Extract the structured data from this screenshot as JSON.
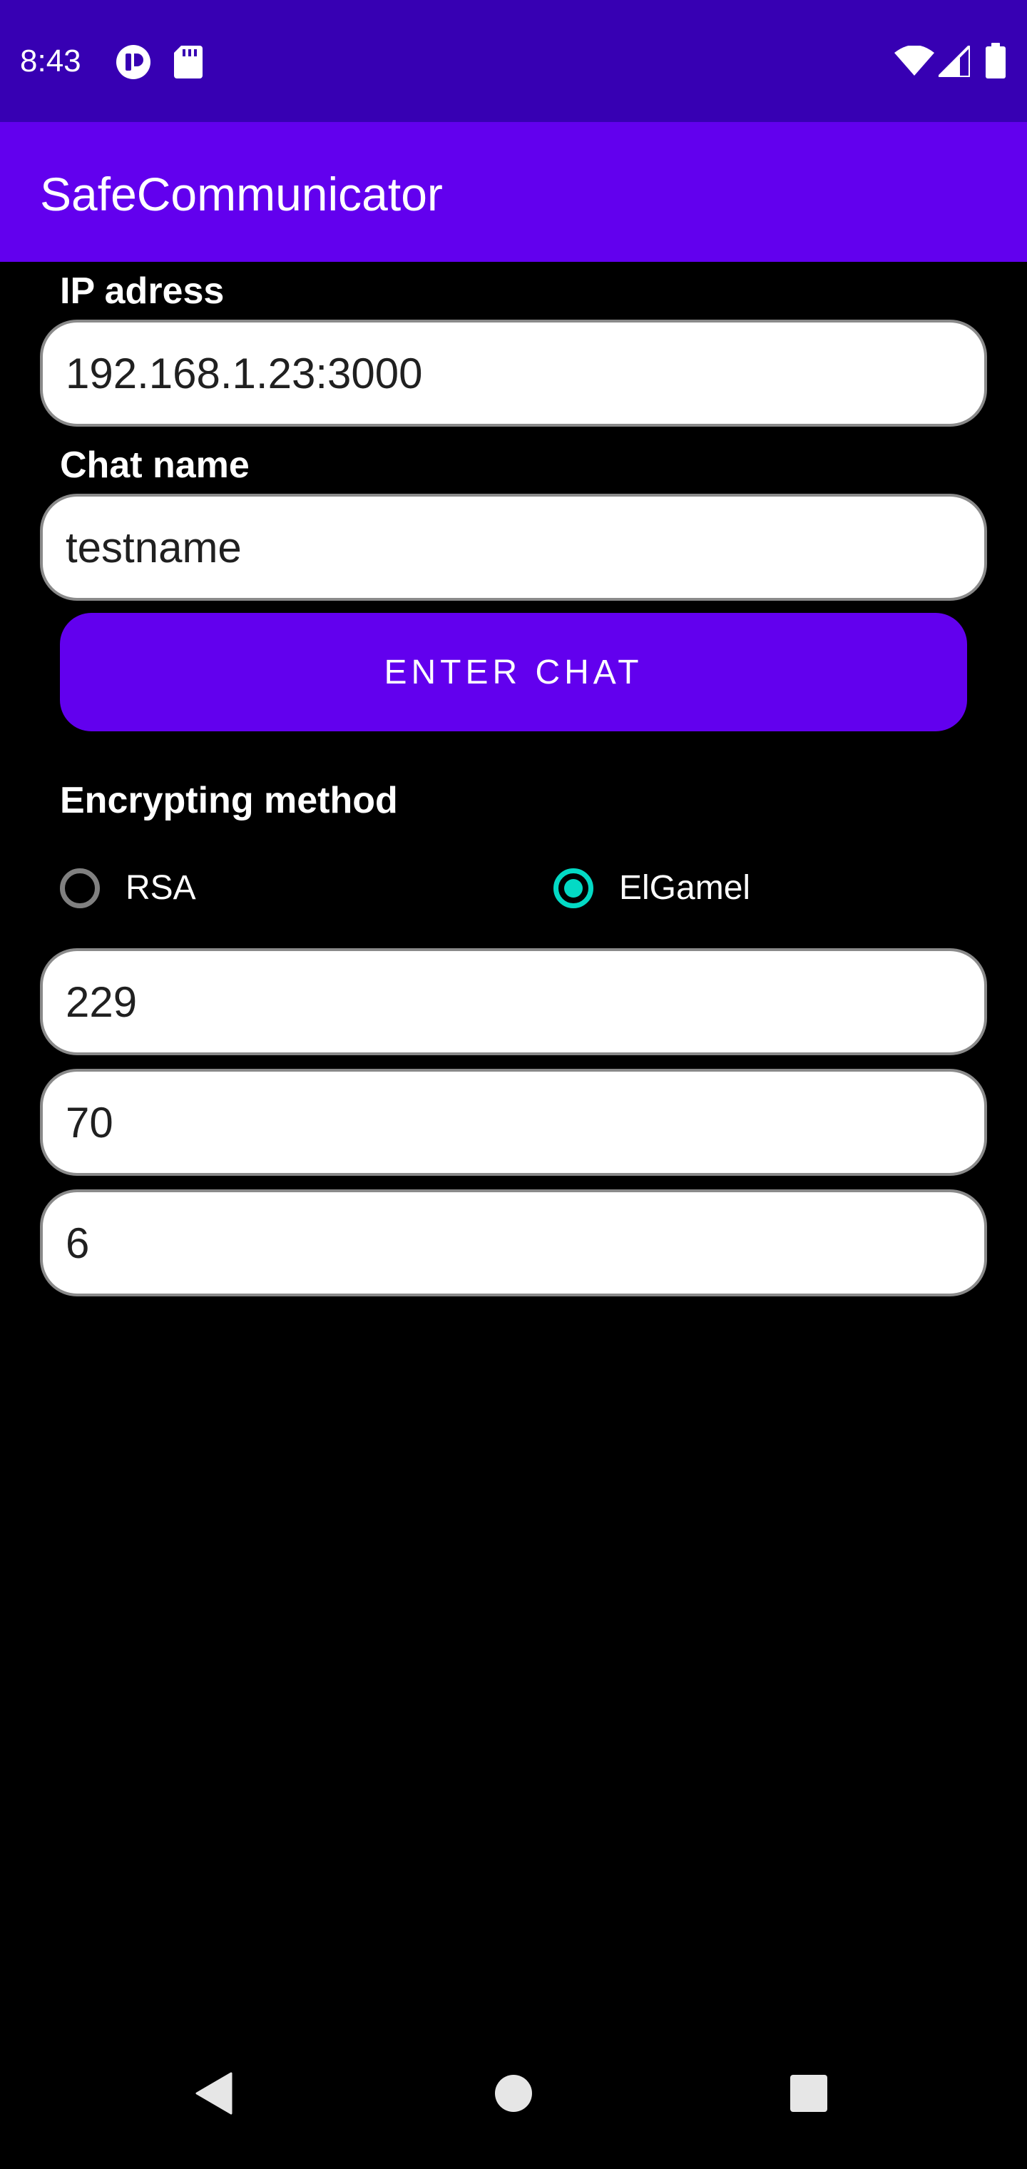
{
  "status_bar": {
    "time": "8:43",
    "icons": [
      "app-notification-icon",
      "sd-card-icon",
      "wifi-icon",
      "signal-icon",
      "battery-icon"
    ],
    "color": "#3700B3"
  },
  "app_bar": {
    "title": "SafeCommunicator",
    "color": "#6200EE"
  },
  "form": {
    "ip_label": "IP adress",
    "ip_value": "192.168.1.23:3000",
    "chat_name_label": "Chat name",
    "chat_name_value": "testname",
    "enter_button_label": "ENTER CHAT",
    "encryption_label": "Encrypting method",
    "methods": [
      {
        "label": "RSA",
        "selected": false
      },
      {
        "label": "ElGamel",
        "selected": true
      }
    ],
    "key_fields": [
      "229",
      "70",
      "6"
    ]
  },
  "colors": {
    "accent": "#03DAC5",
    "primary": "#6200EE",
    "background": "#000000"
  },
  "nav_bar": {
    "icons": [
      "back-icon",
      "home-icon",
      "recents-icon"
    ]
  }
}
